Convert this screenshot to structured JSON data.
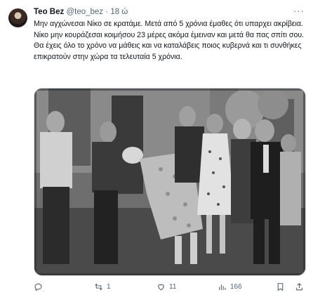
{
  "tweet": {
    "author_name": "Teo Bez",
    "handle": "@teo_bez",
    "separator": "·",
    "time": "18 ώ",
    "more_icon": "more-icon",
    "text": "Μην αγχώνεσαι Νίκο σε κρατάμε. Μετά από 5 χρόνια έμαθες ότι υπαρχει ακρίβεια. Νίκο μην κουράζεσαι κοιμήσου 23 μέρες ακόμα έμειναν και μετά θα πας σπίτι σου. Θα έχεις όλο το χρόνο να μάθεις και να καταλάβεις ποιος κυβερνά και τι συνθήκες επικρατούν στην χώρα τα τελευταία 5 χρόνια.",
    "media_description_icon": "black-and-white-film-still",
    "actions": {
      "reply": {
        "icon": "reply-icon",
        "count": ""
      },
      "retweet": {
        "icon": "retweet-icon",
        "count": "1"
      },
      "like": {
        "icon": "heart-icon",
        "count": "11"
      },
      "views": {
        "icon": "views-icon",
        "count": "166"
      },
      "bookmark": {
        "icon": "bookmark-icon",
        "count": ""
      },
      "share": {
        "icon": "share-icon",
        "count": ""
      }
    },
    "colors": {
      "text": "#0f1419",
      "secondary": "#536471",
      "border": "#cfd9de"
    }
  }
}
